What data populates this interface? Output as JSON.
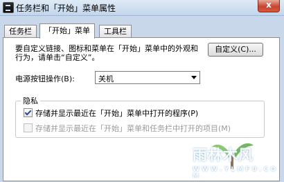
{
  "window": {
    "title": "任务栏和「开始」菜单属性",
    "close_glyph": "x"
  },
  "tabs": [
    {
      "label": "任务栏",
      "active": false
    },
    {
      "label": "「开始」菜单",
      "active": true
    },
    {
      "label": "工具栏",
      "active": false
    }
  ],
  "customize": {
    "description": "要自定义链接、图标和菜单在「开始」菜单中的外观和行为，请单击“自定义”。",
    "button_label": "自定义(C)..."
  },
  "power": {
    "label": "电源按钮操作(B):",
    "selected": "关机"
  },
  "privacy": {
    "group_title": "隐私",
    "option1": {
      "label": "存储并显示最近在「开始」菜单中打开的程序(P)",
      "checked": true,
      "enabled": true
    },
    "option2": {
      "label": "存储并显示最近在「开始」菜单和任务栏中打开的项目(M)",
      "checked": false,
      "enabled": false
    }
  },
  "watermark": {
    "text": "雨林木风",
    "url": "W W W . Y L M F U . C O M"
  }
}
